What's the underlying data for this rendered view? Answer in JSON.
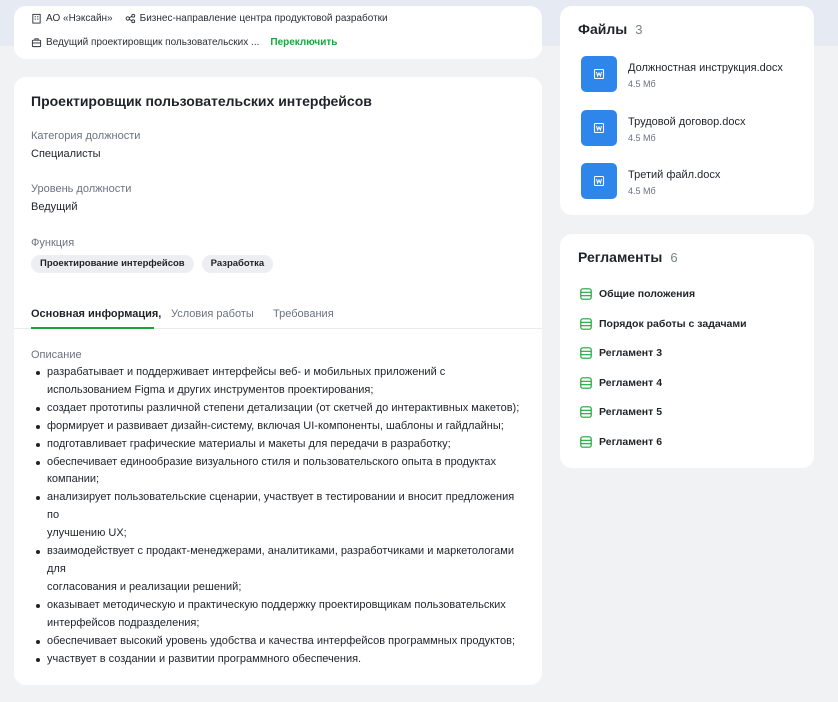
{
  "org": {
    "company": "АО «Нэксайн»",
    "division": "Бизнес-направление центра продуктовой разработки",
    "position_short": "Ведущий проектировщик пользовательских ...",
    "switch_label": "Переключить"
  },
  "main": {
    "title": "Проектировщик пользовательских интерфейсов",
    "category_label": "Категория должности",
    "category_value": "Специалисты",
    "level_label": "Уровень должности",
    "level_value": "Ведущий",
    "function_label": "Функция",
    "function_chips": [
      "Проектирование интерфейсов",
      "Разработка"
    ],
    "tabs": [
      "Основная информация,",
      "Условия работы",
      "Требования"
    ],
    "active_tab": "Основная информация,",
    "description_label": "Описание",
    "description_items": [
      [
        "разрабатывает и поддерживает интерфейсы веб- и мобильных приложений с",
        "использованием Figma и других инструментов проектирования;"
      ],
      [
        "создает прототипы различной степени детализации (от скетчей до интерактивных макетов);"
      ],
      [
        "формирует и развивает дизайн-систему, включая UI-компоненты, шаблоны и гайдлайны;"
      ],
      [
        "подготавливает графические материалы и макеты для передачи в разработку;"
      ],
      [
        "обеспечивает единообразие визуального стиля и пользовательского опыта в продуктах",
        "компании;"
      ],
      [
        "анализирует пользовательские сценарии, участвует в тестировании и вносит предложения",
        "по",
        "улучшению UX;"
      ],
      [
        "взаимодействует с продакт-менеджерами, аналитиками, разработчиками и маркетологами",
        "для",
        "согласования и реализации решений;"
      ],
      [
        "оказывает методическую и практическую поддержку проектировщикам пользовательских",
        "интерфейсов подразделения;"
      ],
      [
        "обеспечивает высокий уровень удобства и качества интерфейсов программных продуктов;"
      ],
      [
        "участвует в создании и развитии программного обеспечения."
      ]
    ]
  },
  "files": {
    "title": "Файлы",
    "count": "3",
    "items": [
      {
        "name": "Должностная инструкция.docx",
        "size": "4.5 Мб"
      },
      {
        "name": "Трудовой договор.docx",
        "size": "4.5 Мб"
      },
      {
        "name": "Третий файл.docx",
        "size": "4.5 Мб"
      }
    ]
  },
  "regulations": {
    "title": "Регламенты",
    "count": "6",
    "items": [
      "Общие положения",
      "Порядок работы с задачами",
      "Регламент 3",
      "Регламент 4",
      "Регламент 5",
      "Регламент 6"
    ]
  },
  "colors": {
    "accent": "#1aa53a",
    "file_icon": "#2f86ea"
  }
}
